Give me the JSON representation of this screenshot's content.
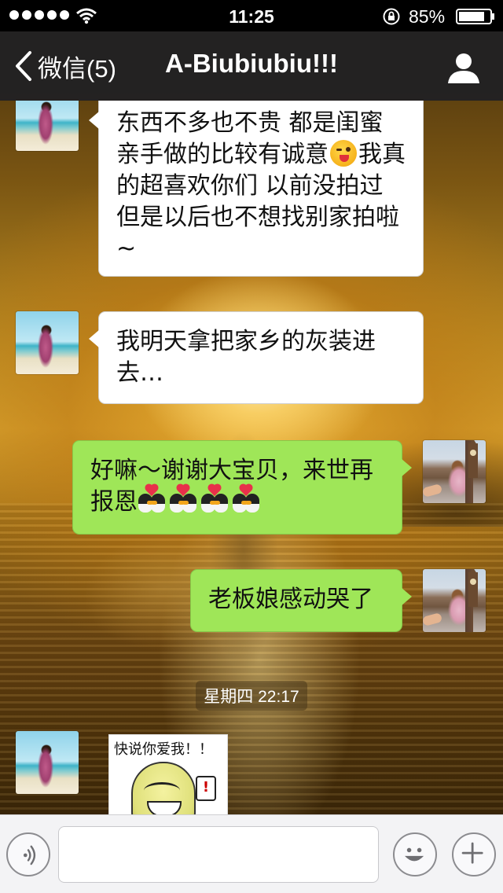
{
  "status_bar": {
    "time": "11:25",
    "battery_percent": "85%",
    "signal_bars": 5
  },
  "nav": {
    "back_label": "微信(5)",
    "title": "A-Biubiubiu!!!"
  },
  "messages": [
    {
      "direction": "incoming",
      "text_before_emoji": "东西不多也不贵 都是闺蜜亲手做的比较有诚意",
      "emoji": "wink-tongue",
      "text_after_emoji": "我真的超喜欢你们 以前没拍过但是以后也不想找别家拍啦~"
    },
    {
      "direction": "incoming",
      "text": "我明天拿把家乡的灰装进去…"
    },
    {
      "direction": "outgoing",
      "text": "好嘛～谢谢大宝贝，来世再报恩",
      "emoji": "kissing-penguins",
      "emoji_count": 4
    },
    {
      "direction": "outgoing",
      "text": "老板娘感动哭了"
    }
  ],
  "timestamp": "星期四 22:17",
  "sticker": {
    "text": "快说你爱我！！",
    "mark": "!"
  },
  "colors": {
    "outgoing_bubble": "#9fe658",
    "incoming_bubble": "#ffffff",
    "nav_background": "#212123"
  },
  "icons": {
    "back": "chevron-left-icon",
    "profile": "person-icon",
    "voice": "voice-icon",
    "emoji": "smiley-icon",
    "add": "plus-icon",
    "wifi": "wifi-icon",
    "rotation_lock": "rotation-lock-icon",
    "battery": "battery-icon"
  }
}
